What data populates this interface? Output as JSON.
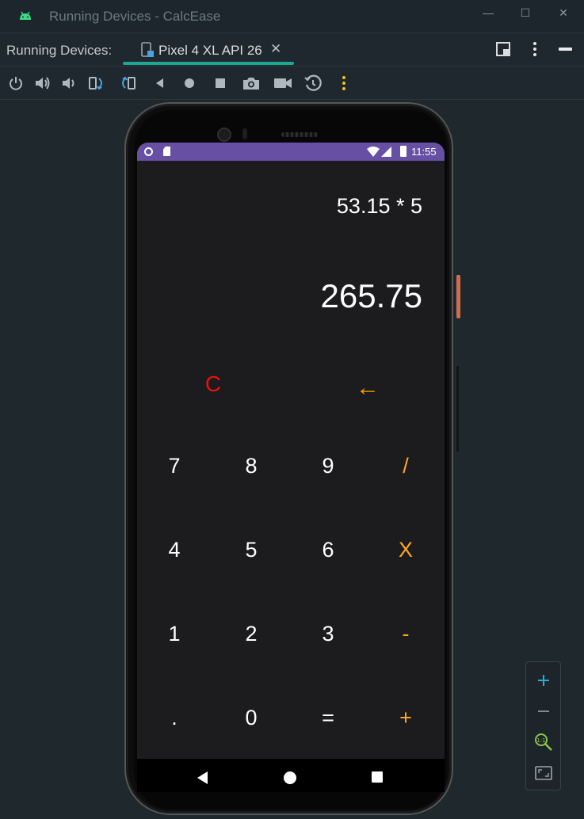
{
  "window": {
    "title": "Running Devices - CalcEase",
    "controls": {
      "minimize": "—",
      "maximize": "☐",
      "close": "✕"
    }
  },
  "tabbar": {
    "label": "Running Devices:",
    "device_tab": "Pixel 4 XL API 26",
    "close_glyph": "✕"
  },
  "toolbar": {
    "icons": [
      "power-icon",
      "volume-up-icon",
      "volume-down-icon",
      "rotate-left-icon",
      "rotate-right-icon",
      "back-icon",
      "home-icon",
      "overview-icon",
      "screenshot-icon",
      "screen-record-icon",
      "snapshot-icon",
      "more-icon"
    ]
  },
  "statusbar": {
    "time": "11:55"
  },
  "calculator": {
    "expression": "53.15 * 5",
    "result": "265.75",
    "clear": "C",
    "backspace": "←",
    "keys": [
      [
        "7",
        "8",
        "9",
        "/"
      ],
      [
        "4",
        "5",
        "6",
        "X"
      ],
      [
        "1",
        "2",
        "3",
        "-"
      ],
      [
        ".",
        "0",
        "=",
        "+"
      ]
    ],
    "colors": {
      "background": "#1c1c1e",
      "digit": "#ffffff",
      "operator": "#ffa726",
      "clear": "#e8110f",
      "statusbar": "#6750a4"
    }
  },
  "zoom_panel": {
    "icons": [
      "zoom-in-icon",
      "zoom-out-icon",
      "actual-size-icon",
      "fit-screen-icon"
    ]
  }
}
